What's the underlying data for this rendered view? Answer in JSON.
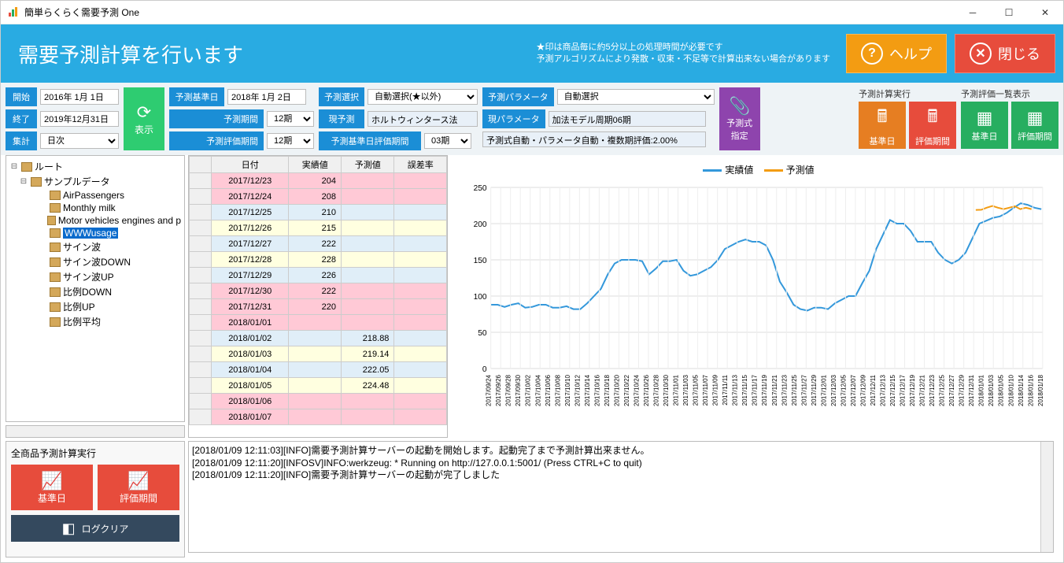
{
  "window_title": "簡単らくらく需要予測 One",
  "banner": {
    "title": "需要予測計算を行います",
    "note1": "★印は商品毎に約5分以上の処理時間が必要です",
    "note2": "予測アルゴリズムにより発散・収束・不足等で計算出来ない場合があります",
    "help": "ヘルプ",
    "close": "閉じる"
  },
  "toolbar": {
    "start_lbl": "開始",
    "start_val": "2016年 1月 1日",
    "end_lbl": "終了",
    "end_val": "2019年12月31日",
    "agg_lbl": "集計",
    "agg_val": "日次",
    "show": "表示",
    "base_date_lbl": "予測基準日",
    "base_date_val": "2018年 1月 2日",
    "period_lbl": "予測期間",
    "period_val": "12期",
    "eval_period_lbl": "予測評価期間",
    "eval_period_val": "12期",
    "select_lbl": "予測選択",
    "select_val": "自動選択(★以外)",
    "current_lbl": "現予測",
    "current_val": "ホルトウィンタース法",
    "base_eval_lbl": "予測基準日評価期間",
    "base_eval_val": "03期",
    "param_lbl": "予測パラメータ",
    "param_val": "自動選択",
    "cur_param_lbl": "現パラメータ",
    "cur_param_val": "加法モデル周期06期",
    "formula_status": "予測式自動・パラメータ自動・複数期評価:2.00%",
    "formula_btn": "予測式\n指定",
    "exec_title": "予測計算実行",
    "list_title": "予測評価一覧表示",
    "btn_base": "基準日",
    "btn_eval": "評価期間"
  },
  "tree": {
    "root": "ルート",
    "sample": "サンプルデータ",
    "items": [
      "AirPassengers",
      "Monthly milk",
      "Motor vehicles engines and p",
      "WWWusage",
      "サイン波",
      "サイン波DOWN",
      "サイン波UP",
      "比例DOWN",
      "比例UP",
      "比例平均"
    ],
    "selected_index": 3
  },
  "table": {
    "headers": [
      "日付",
      "実績値",
      "予測値",
      "誤差率"
    ],
    "rows": [
      {
        "date": "2017/12/23",
        "actual": "204",
        "forecast": "",
        "err": "",
        "cls": "pink"
      },
      {
        "date": "2017/12/24",
        "actual": "208",
        "forecast": "",
        "err": "",
        "cls": "pink"
      },
      {
        "date": "2017/12/25",
        "actual": "210",
        "forecast": "",
        "err": "",
        "cls": "lblue"
      },
      {
        "date": "2017/12/26",
        "actual": "215",
        "forecast": "",
        "err": "",
        "cls": "lyellow"
      },
      {
        "date": "2017/12/27",
        "actual": "222",
        "forecast": "",
        "err": "",
        "cls": "lblue"
      },
      {
        "date": "2017/12/28",
        "actual": "228",
        "forecast": "",
        "err": "",
        "cls": "lyellow"
      },
      {
        "date": "2017/12/29",
        "actual": "226",
        "forecast": "",
        "err": "",
        "cls": "lblue"
      },
      {
        "date": "2017/12/30",
        "actual": "222",
        "forecast": "",
        "err": "",
        "cls": "pink"
      },
      {
        "date": "2017/12/31",
        "actual": "220",
        "forecast": "",
        "err": "",
        "cls": "pink"
      },
      {
        "date": "2018/01/01",
        "actual": "",
        "forecast": "",
        "err": "",
        "cls": "pink"
      },
      {
        "date": "2018/01/02",
        "actual": "",
        "forecast": "218.88",
        "err": "",
        "cls": "lblue"
      },
      {
        "date": "2018/01/03",
        "actual": "",
        "forecast": "219.14",
        "err": "",
        "cls": "lyellow"
      },
      {
        "date": "2018/01/04",
        "actual": "",
        "forecast": "222.05",
        "err": "",
        "cls": "lblue"
      },
      {
        "date": "2018/01/05",
        "actual": "",
        "forecast": "224.48",
        "err": "",
        "cls": "lyellow"
      },
      {
        "date": "2018/01/06",
        "actual": "",
        "forecast": "",
        "err": "",
        "cls": "pink"
      },
      {
        "date": "2018/01/07",
        "actual": "",
        "forecast": "",
        "err": "",
        "cls": "pink"
      }
    ]
  },
  "bottom_left": {
    "title": "全商品予測計算実行",
    "base": "基準日",
    "eval": "評価期間",
    "logclear": "ログクリア"
  },
  "chart_data": {
    "type": "line",
    "legend": {
      "actual": "実績値",
      "forecast": "予測値"
    },
    "ylim": [
      0,
      250
    ],
    "yticks": [
      0,
      50,
      100,
      150,
      200,
      250
    ],
    "categories": [
      "2017/09/24",
      "2017/09/26",
      "2017/09/28",
      "2017/09/30",
      "2017/10/02",
      "2017/10/04",
      "2017/10/06",
      "2017/10/08",
      "2017/10/10",
      "2017/10/12",
      "2017/10/14",
      "2017/10/16",
      "2017/10/18",
      "2017/10/20",
      "2017/10/22",
      "2017/10/24",
      "2017/10/26",
      "2017/10/28",
      "2017/10/30",
      "2017/11/01",
      "2017/11/03",
      "2017/11/05",
      "2017/11/07",
      "2017/11/09",
      "2017/11/11",
      "2017/11/13",
      "2017/11/15",
      "2017/11/17",
      "2017/11/19",
      "2017/11/21",
      "2017/11/23",
      "2017/11/25",
      "2017/11/27",
      "2017/11/29",
      "2017/12/01",
      "2017/12/03",
      "2017/12/05",
      "2017/12/07",
      "2017/12/09",
      "2017/12/11",
      "2017/12/13",
      "2017/12/15",
      "2017/12/17",
      "2017/12/19",
      "2017/12/21",
      "2017/12/23",
      "2017/12/25",
      "2017/12/27",
      "2017/12/29",
      "2017/12/31",
      "2018/01/01",
      "2018/01/03",
      "2018/01/05",
      "2018/01/10",
      "2018/01/14",
      "2018/01/16",
      "2018/01/18"
    ],
    "series": [
      {
        "name": "実績値",
        "color": "#3498db",
        "values": [
          88,
          88,
          85,
          88,
          90,
          84,
          85,
          88,
          88,
          84,
          84,
          86,
          82,
          82,
          90,
          100,
          110,
          130,
          145,
          150,
          150,
          150,
          148,
          130,
          138,
          148,
          148,
          150,
          135,
          128,
          130,
          135,
          140,
          150,
          165,
          170,
          175,
          178,
          175,
          175,
          170,
          150,
          120,
          105,
          88,
          82,
          80,
          84,
          84,
          82,
          90,
          95,
          100,
          100,
          118,
          135,
          165,
          185,
          205,
          200,
          200,
          190,
          175,
          175,
          175,
          160,
          150,
          145,
          150,
          160,
          180,
          200,
          204,
          208,
          210,
          215,
          222,
          228,
          226,
          222,
          220
        ]
      },
      {
        "name": "予測値",
        "color": "#f39c12",
        "values": [
          218.88,
          219.14,
          222.05,
          224.48,
          222,
          220,
          222,
          224,
          220,
          222,
          220
        ]
      }
    ]
  },
  "log": [
    "[2018/01/09 12:11:03][INFO]需要予測計算サーバーの起動を開始します。起動完了まで予測計算出来ません。",
    "[2018/01/09 12:11:20][INFOSV]INFO:werkzeug: * Running on http://127.0.0.1:5001/ (Press CTRL+C to quit)",
    "[2018/01/09 12:11:20][INFO]需要予測計算サーバーの起動が完了しました"
  ]
}
